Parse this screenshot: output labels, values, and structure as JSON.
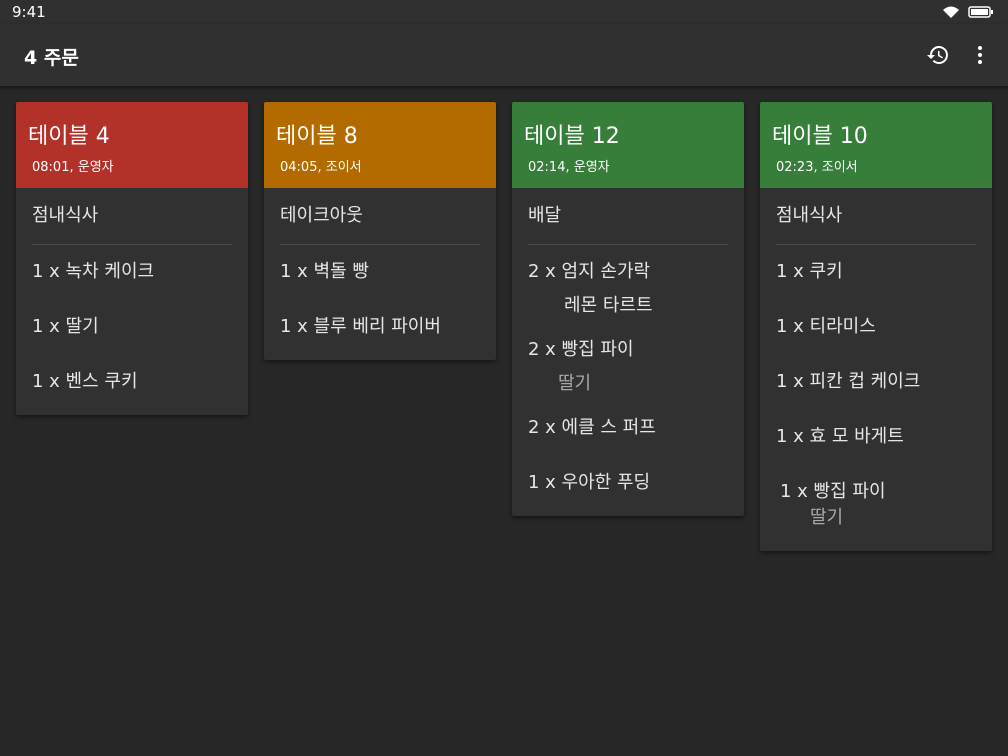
{
  "status": {
    "time": "9:41"
  },
  "appbar": {
    "title": "4 주문",
    "history_icon": "history-icon",
    "more_icon": "more-vert-icon"
  },
  "colors": {
    "red": "#b2322a",
    "orange": "#b36b00",
    "green": "#367e3a"
  },
  "cards": [
    {
      "title": "테이블 4",
      "sub": "08:01, 운영자",
      "type": "점내식사",
      "items": [
        {
          "text": "1 x 녹차 케이크",
          "note": ""
        },
        {
          "text": "1 x 딸기",
          "note": ""
        },
        {
          "text": "1 x 벤스 쿠키",
          "note": ""
        }
      ]
    },
    {
      "title": "테이블 8",
      "sub": "04:05, 조이서",
      "type": "테이크아웃",
      "items": [
        {
          "text": "1 x 벽돌 빵",
          "note": ""
        },
        {
          "text": "1 x 블루 베리 파이버",
          "note": ""
        }
      ]
    },
    {
      "title": "테이블 12",
      "sub": "02:14, 운영자",
      "type": "배달",
      "items": [
        {
          "text": "2 x 엄지 손가락",
          "note": "레몬 타르트",
          "note_color": "#e6e6e6"
        },
        {
          "text": "2 x 빵집 파이",
          "note": "딸기"
        },
        {
          "text": "2 x 에클 스 퍼프",
          "note": ""
        },
        {
          "text": "1 x 우아한 푸딩",
          "note": ""
        }
      ]
    },
    {
      "title": "테이블 10",
      "sub": "02:23, 조이서",
      "type": "점내식사",
      "items": [
        {
          "text": "1 x 쿠키",
          "note": ""
        },
        {
          "text": "1 x 티라미스",
          "note": ""
        },
        {
          "text": "1 x 피칸 컵 케이크",
          "note": ""
        },
        {
          "text": "1 x 효 모 바게트",
          "note": ""
        },
        {
          "text": "1 x 빵집 파이",
          "note": "딸기"
        }
      ]
    }
  ]
}
